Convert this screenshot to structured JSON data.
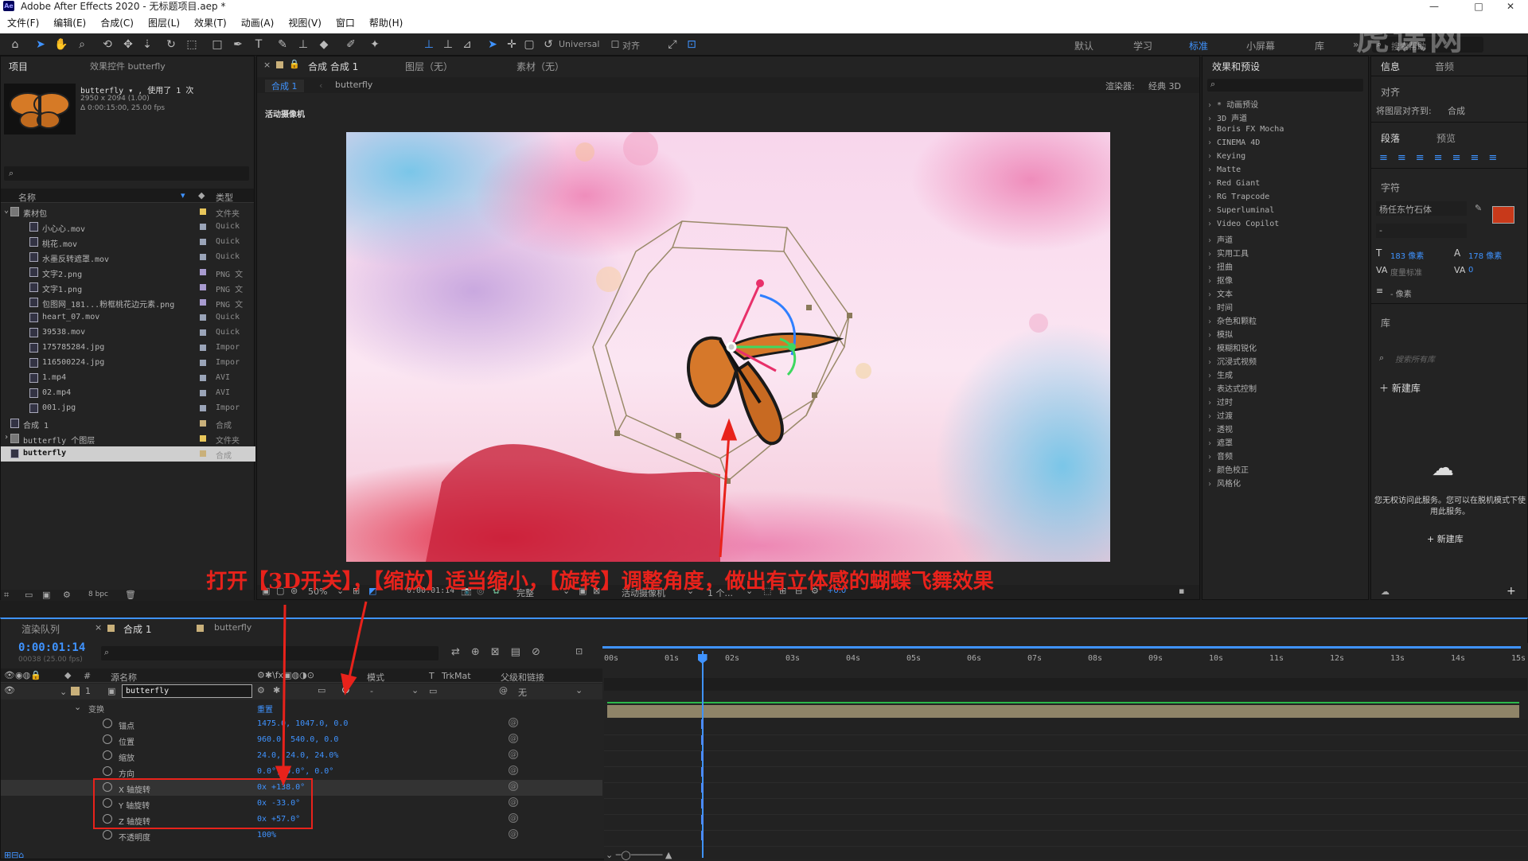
{
  "window": {
    "title": "Adobe After Effects 2020 - 无标题项目.aep *",
    "logo": "Ae",
    "controls": [
      "—",
      "□",
      "✕"
    ]
  },
  "menu": [
    "文件(F)",
    "编辑(E)",
    "合成(C)",
    "图层(L)",
    "效果(T)",
    "动画(A)",
    "视图(V)",
    "窗口",
    "帮助(H)"
  ],
  "toolbar": {
    "universal": "Universal",
    "align_label": "对齐",
    "workspaces": [
      "默认",
      "学习",
      "标准",
      "小屏幕",
      "库"
    ],
    "active_workspace": "标准",
    "search_placeholder": "搜索帮助",
    "more": "»"
  },
  "project": {
    "tabs": [
      "项目",
      "效果控件 butterfly"
    ],
    "item_name": "butterfly ▾ , 使用了 1 次",
    "item_size": "2950 x 2094 (1.00)",
    "item_dur": "Δ 0:00:15:00, 25.00 fps",
    "search_placeholder": "",
    "col_name": "名称",
    "col_type": "类型",
    "items": [
      {
        "name": "素材包",
        "type": "文件夹",
        "color": "#e8c65a",
        "folder": true,
        "indent": 0
      },
      {
        "name": "小心心.mov",
        "type": "Quick",
        "color": "#9aa4b8",
        "indent": 1
      },
      {
        "name": "桃花.mov",
        "type": "Quick",
        "color": "#9aa4b8",
        "indent": 1
      },
      {
        "name": "水墨反转遮罩.mov",
        "type": "Quick",
        "color": "#9aa4b8",
        "indent": 1
      },
      {
        "name": "文字2.png",
        "type": "PNG 文",
        "color": "#a89bd0",
        "indent": 1
      },
      {
        "name": "文字1.png",
        "type": "PNG 文",
        "color": "#a89bd0",
        "indent": 1
      },
      {
        "name": "包图网_181...粉框桃花边元素.png",
        "type": "PNG 文",
        "color": "#a89bd0",
        "indent": 1
      },
      {
        "name": "heart_07.mov",
        "type": "Quick",
        "color": "#9aa4b8",
        "indent": 1
      },
      {
        "name": "39538.mov",
        "type": "Quick",
        "color": "#9aa4b8",
        "indent": 1
      },
      {
        "name": "175785284.jpg",
        "type": "Impor",
        "color": "#9aa4b8",
        "indent": 1
      },
      {
        "name": "116500224.jpg",
        "type": "Impor",
        "color": "#9aa4b8",
        "indent": 1
      },
      {
        "name": "1.mp4",
        "type": "AVI",
        "color": "#9aa4b8",
        "indent": 1
      },
      {
        "name": "02.mp4",
        "type": "AVI",
        "color": "#9aa4b8",
        "indent": 1
      },
      {
        "name": "001.jpg",
        "type": "Impor",
        "color": "#9aa4b8",
        "indent": 1
      },
      {
        "name": "合成 1",
        "type": "合成",
        "color": "#c9b07a",
        "indent": 0
      },
      {
        "name": "butterfly 个图层",
        "type": "文件夹",
        "color": "#e8c65a",
        "folder": true,
        "indent": 0
      },
      {
        "name": "butterfly",
        "type": "合成",
        "color": "#c9b07a",
        "indent": 0,
        "selected": true
      }
    ],
    "bpc": "8 bpc"
  },
  "composition": {
    "tabs": [
      "合成 合成 1",
      "图层（无）",
      "素材（无）"
    ],
    "breadcrumbs": [
      "合成 1",
      "butterfly"
    ],
    "renderer_label": "渲染器:",
    "renderer_value": "经典 3D",
    "camera_label": "活动摄像机",
    "footer": {
      "zoom": "50%",
      "timecode": "0:00:01:14",
      "quality": "完整",
      "view": "活动摄像机",
      "views": "1 个...",
      "exposure": "+0.0"
    }
  },
  "annotation": {
    "caption": "打开【3D开关】，【缩放】适当缩小，【旋转】调整角度，做出有立体感的蝴蝶飞舞效果",
    "color": "#e8221b"
  },
  "effects": {
    "tab": "效果和预设",
    "search_placeholder": "",
    "items": [
      "* 动画预设",
      "3D 声道",
      "Boris FX Mocha",
      "CINEMA 4D",
      "Keying",
      "Matte",
      "Red Giant",
      "RG Trapcode",
      "Superluminal",
      "Video Copilot",
      "声道",
      "实用工具",
      "扭曲",
      "抠像",
      "文本",
      "时间",
      "杂色和颗粒",
      "模拟",
      "模糊和锐化",
      "沉浸式视频",
      "生成",
      "表达式控制",
      "过时",
      "过渡",
      "透视",
      "遮罩",
      "音频",
      "颜色校正",
      "风格化"
    ]
  },
  "right": {
    "tabs1": [
      "信息",
      "音频"
    ],
    "align": {
      "title": "对齐",
      "align_to_label": "将图层对齐到:",
      "align_to_value": "合成"
    },
    "paragraph": {
      "tabs": [
        "段落",
        "预览"
      ]
    },
    "character": {
      "title": "字符",
      "font": "杨任东竹石体",
      "style": "-",
      "size": "183 像素",
      "leading": "178 像素",
      "tracking_label": "度量标准",
      "kerning": "0",
      "stroke": "- 像素",
      "fill_color": "#c8391a"
    },
    "library": {
      "title": "库",
      "search_placeholder": "搜索所有库",
      "new_lib": "新建库",
      "offline_msg": "您无权访问此服务。您可以在脱机模式下使用此服务。",
      "new_lib_btn": "+ 新建库"
    }
  },
  "timeline": {
    "tabs": [
      "渲染队列",
      "合成 1",
      "butterfly"
    ],
    "timecode": "0:00:01:14",
    "frame_info": "00038 (25.00 fps)",
    "search_placeholder": "",
    "headers": {
      "num": "#",
      "src": "源名称",
      "mode": "模式",
      "t": "T",
      "trkmat": "TrkMat",
      "parent": "父级和链接"
    },
    "layer": {
      "num": "1",
      "name": "butterfly",
      "mode": "-",
      "parent": "无"
    },
    "transform": "变换",
    "reset": "重置",
    "props": [
      {
        "name": "锚点",
        "value": "1475.0, 1047.0, 0.0"
      },
      {
        "name": "位置",
        "value": "960.0, 540.0, 0.0"
      },
      {
        "name": "缩放",
        "value": "24.0, 24.0, 24.0%"
      },
      {
        "name": "方向",
        "value": "0.0°, 0.0°, 0.0°"
      },
      {
        "name": "X 轴旋转",
        "value": "0x +138.0°"
      },
      {
        "name": "Y 轴旋转",
        "value": "0x -33.0°"
      },
      {
        "name": "Z 轴旋转",
        "value": "0x +57.0°"
      },
      {
        "name": "不透明度",
        "value": "100%"
      }
    ],
    "ruler": [
      "00s",
      "01s",
      "02s",
      "03s",
      "04s",
      "05s",
      "06s",
      "07s",
      "08s",
      "09s",
      "10s",
      "11s",
      "12s",
      "13s",
      "14s",
      "15s"
    ],
    "playhead_seconds": 1.56
  },
  "watermark": "虎课网"
}
